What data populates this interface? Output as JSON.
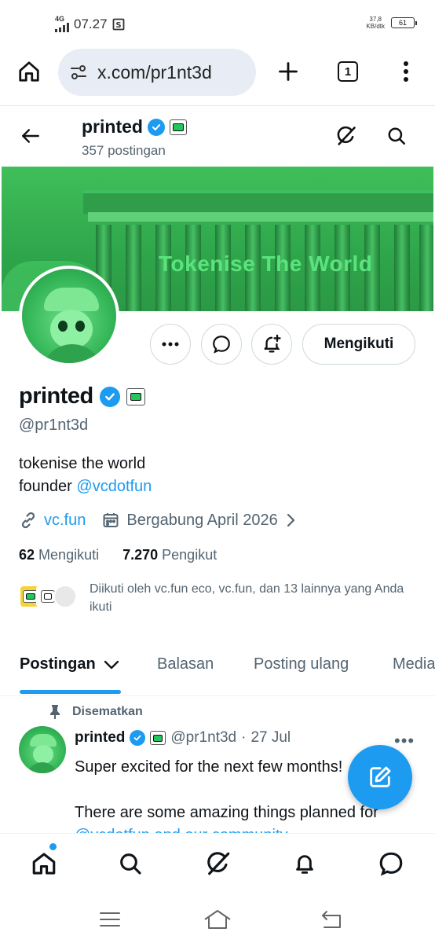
{
  "status_bar": {
    "network": "4G",
    "time": "07.27",
    "speed_value": "37,8",
    "speed_unit": "KB/dtk",
    "battery": "61"
  },
  "browser": {
    "url": "x.com/pr1nt3d",
    "tab_count": "1"
  },
  "profile_header": {
    "name": "printed",
    "post_count": "357 postingan"
  },
  "banner": {
    "text": "Tokenise The World"
  },
  "actions": {
    "follow_label": "Mengikuti"
  },
  "profile": {
    "name": "printed",
    "handle": "@pr1nt3d",
    "bio_line1": "tokenise the world",
    "bio_line2_prefix": "founder ",
    "bio_mention": "@vcdotfun",
    "website": "vc.fun",
    "joined": "Bergabung April 2026",
    "following_count": "62",
    "following_label": "Mengikuti",
    "followers_count": "7.270",
    "followers_label": "Pengikut",
    "followed_by": "Diikuti oleh vc.fun eco, vc.fun, dan 13 lainnya yang Anda ikuti"
  },
  "tabs": [
    {
      "label": "Postingan"
    },
    {
      "label": "Balasan"
    },
    {
      "label": "Posting ulang"
    },
    {
      "label": "Media"
    }
  ],
  "pinned_post": {
    "pinned_label": "Disematkan",
    "author_name": "printed",
    "author_handle": "@pr1nt3d",
    "separator": "·",
    "date": "27 Jul",
    "more": "•••",
    "line1": "Super excited for the next few months!",
    "line2": "There are some amazing things planned for",
    "line3": "@vcdotfun and our community."
  },
  "colors": {
    "accent": "#1d9bf0",
    "banner_green": "#3fbf5a",
    "text_secondary": "#536471"
  }
}
